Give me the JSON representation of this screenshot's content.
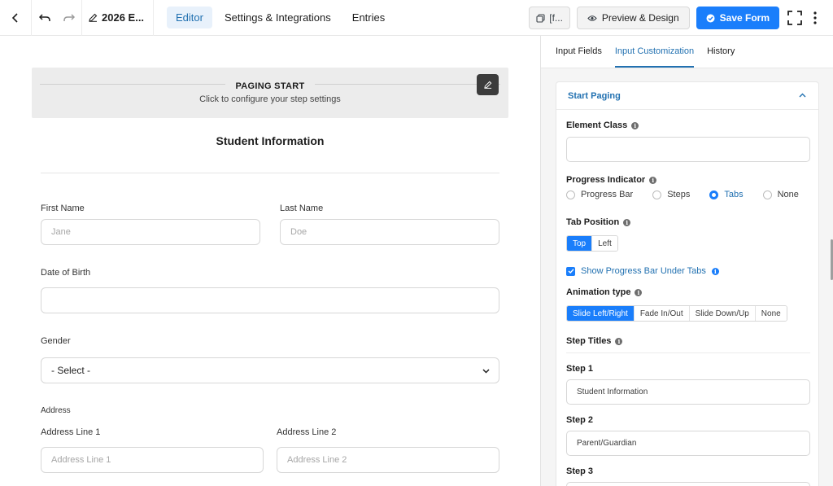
{
  "topbar": {
    "form_title": "2026 E...",
    "tabs": [
      "Editor",
      "Settings & Integrations",
      "Entries"
    ],
    "shortcode_label": "[f...",
    "preview_label": "Preview & Design",
    "save_label": "Save Form"
  },
  "canvas": {
    "paging_title": "PAGING START",
    "paging_subtitle": "Click to configure your step settings",
    "section_title": "Student Information",
    "first_name_label": "First Name",
    "first_name_placeholder": "Jane",
    "last_name_label": "Last Name",
    "last_name_placeholder": "Doe",
    "dob_label": "Date of Birth",
    "gender_label": "Gender",
    "gender_value": "- Select -",
    "address_group_label": "Address",
    "address1_label": "Address Line 1",
    "address1_placeholder": "Address Line 1",
    "address2_label": "Address Line 2",
    "address2_placeholder": "Address Line 2"
  },
  "panel": {
    "tabs": [
      "Input Fields",
      "Input Customization",
      "History"
    ],
    "card_title": "Start Paging",
    "element_class_label": "Element Class",
    "progress_indicator_label": "Progress Indicator",
    "progress_options": [
      "Progress Bar",
      "Steps",
      "Tabs",
      "None"
    ],
    "tab_position_label": "Tab Position",
    "tab_position_options": [
      "Top",
      "Left"
    ],
    "show_progress_label": "Show Progress Bar Under Tabs",
    "animation_label": "Animation type",
    "animation_options": [
      "Slide Left/Right",
      "Fade In/Out",
      "Slide Down/Up",
      "None"
    ],
    "step_titles_label": "Step Titles",
    "steps": [
      {
        "label": "Step 1",
        "value": "Student Information"
      },
      {
        "label": "Step 2",
        "value": "Parent/Guardian"
      },
      {
        "label": "Step 3",
        "value": ""
      }
    ]
  },
  "colors": {
    "accent": "#1a7efb",
    "link": "#2271b1"
  }
}
